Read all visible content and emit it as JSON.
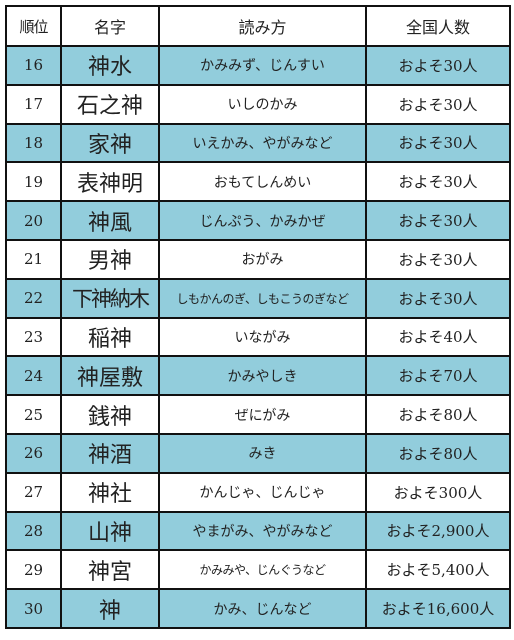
{
  "table": {
    "headers": [
      "順位",
      "名字",
      "読み方",
      "全国人数"
    ],
    "colors": {
      "alt_row": "#92cddc",
      "plain_row": "#ffffff",
      "border": "#111111"
    },
    "rows": [
      {
        "rank": "16",
        "name": "神水",
        "reading": "かみみず、じんすい",
        "count": "およそ30人"
      },
      {
        "rank": "17",
        "name": "石之神",
        "reading": "いしのかみ",
        "count": "およそ30人"
      },
      {
        "rank": "18",
        "name": "家神",
        "reading": "いえかみ、やがみなど",
        "count": "およそ30人"
      },
      {
        "rank": "19",
        "name": "表神明",
        "reading": "おもてしんめい",
        "count": "およそ30人"
      },
      {
        "rank": "20",
        "name": "神風",
        "reading": "じんぷう、かみかぜ",
        "count": "およそ30人"
      },
      {
        "rank": "21",
        "name": "男神",
        "reading": "おがみ",
        "count": "およそ30人"
      },
      {
        "rank": "22",
        "name": "下神納木",
        "reading": "しもかんのぎ、しもこうのぎなど",
        "count": "およそ30人"
      },
      {
        "rank": "23",
        "name": "稲神",
        "reading": "いながみ",
        "count": "およそ40人"
      },
      {
        "rank": "24",
        "name": "神屋敷",
        "reading": "かみやしき",
        "count": "およそ70人"
      },
      {
        "rank": "25",
        "name": "銭神",
        "reading": "ぜにがみ",
        "count": "およそ80人"
      },
      {
        "rank": "26",
        "name": "神酒",
        "reading": "みき",
        "count": "およそ80人"
      },
      {
        "rank": "27",
        "name": "神社",
        "reading": "かんじゃ、じんじゃ",
        "count": "およそ300人"
      },
      {
        "rank": "28",
        "name": "山神",
        "reading": "やまがみ、やがみなど",
        "count": "およそ2,900人"
      },
      {
        "rank": "29",
        "name": "神宮",
        "reading": "かみみや、じんぐうなど",
        "count": "およそ5,400人"
      },
      {
        "rank": "30",
        "name": "神",
        "reading": "かみ、じんなど",
        "count": "およそ16,600人"
      }
    ]
  }
}
